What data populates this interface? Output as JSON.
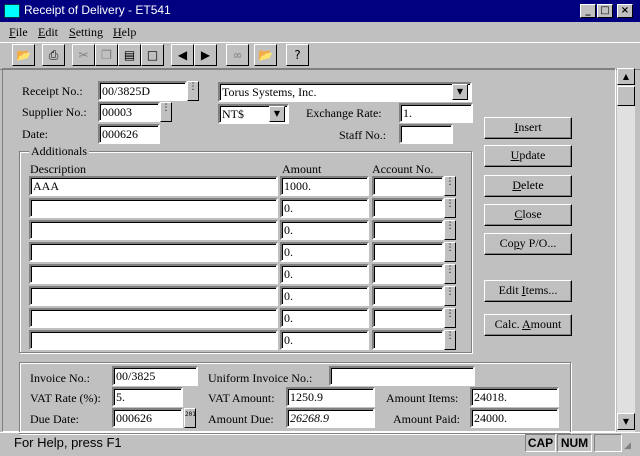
{
  "window": {
    "title": "Receipt of Delivery - ET541"
  },
  "menu": [
    {
      "label": "File",
      "hot": "F",
      "rest": "ile"
    },
    {
      "label": "Edit",
      "hot": "E",
      "rest": "dit"
    },
    {
      "label": "Setting",
      "hot": "S",
      "rest": "etting"
    },
    {
      "label": "Help",
      "hot": "H",
      "rest": "elp"
    }
  ],
  "toolbar_icons": [
    "open-folder-icon",
    "print-icon",
    "cut-icon",
    "copy-icon",
    "paste-icon",
    "new-icon",
    "previous-icon",
    "next-icon",
    "find-icon",
    "open-icon",
    "help-icon"
  ],
  "header": {
    "receipt_label": "Receipt No.:",
    "receipt_value": "00/3825D",
    "company_value": "Torus Systems, Inc.",
    "supplier_label": "Supplier No.:",
    "supplier_value": "00003",
    "currency_value": "NT$",
    "exchange_label": "Exchange Rate:",
    "exchange_value": "1.",
    "date_label": "Date:",
    "date_value": "000626",
    "staff_label": "Staff No.:",
    "staff_value": ""
  },
  "additionals": {
    "title": "Additionals",
    "col_description": "Description",
    "col_amount": "Amount",
    "col_account": "Account No.",
    "rows": [
      {
        "description": "AAA",
        "amount": "1000.",
        "account": ""
      },
      {
        "description": "",
        "amount": "0.",
        "account": ""
      },
      {
        "description": "",
        "amount": "0.",
        "account": ""
      },
      {
        "description": "",
        "amount": "0.",
        "account": ""
      },
      {
        "description": "",
        "amount": "0.",
        "account": ""
      },
      {
        "description": "",
        "amount": "0.",
        "account": ""
      },
      {
        "description": "",
        "amount": "0.",
        "account": ""
      },
      {
        "description": "",
        "amount": "0.",
        "account": ""
      }
    ]
  },
  "buttons": {
    "insert": {
      "hot": "I",
      "rest": "nsert"
    },
    "update": {
      "hot": "U",
      "rest": "pdate"
    },
    "delete": {
      "hot": "D",
      "rest": "elete"
    },
    "close": {
      "hot": "C",
      "rest": "lose"
    },
    "copy_po": {
      "pre": "Co",
      "hot": "p",
      "rest": "y P/O..."
    },
    "edit_items": {
      "pre": "Edit ",
      "hot": "I",
      "rest": "tems..."
    },
    "calc_amount": {
      "pre": "Calc. ",
      "hot": "A",
      "rest": "mount"
    }
  },
  "invoice": {
    "invoice_label": "Invoice No.:",
    "invoice_value": "00/3825",
    "uniform_label": "Uniform Invoice No.:",
    "uniform_value": "",
    "vat_rate_label": "VAT Rate (%):",
    "vat_rate_value": "5.",
    "vat_amount_label": "VAT Amount:",
    "vat_amount_value": "1250.9",
    "amount_items_label": "Amount Items:",
    "amount_items_value": "24018.",
    "due_date_label": "Due Date:",
    "due_date_value": "000626",
    "amount_due_label": "Amount Due:",
    "amount_due_value": "26268.9",
    "amount_paid_label": "Amount Paid:",
    "amount_paid_value": "24000.",
    "calendar_glyph": "2010"
  },
  "status": {
    "help_text": "For Help, press F1",
    "cap": "CAP",
    "num": "NUM"
  }
}
